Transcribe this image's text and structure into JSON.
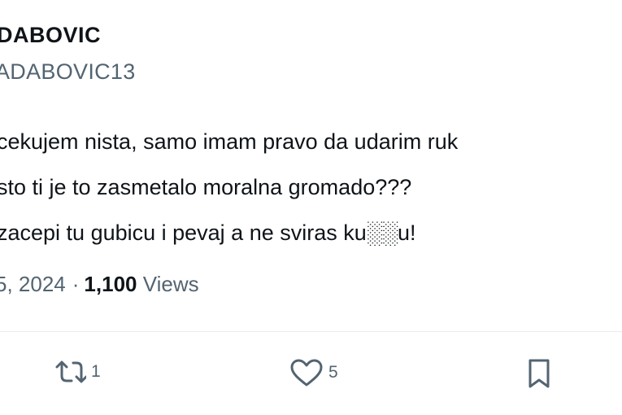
{
  "author": {
    "display_name": "DABOVIC",
    "handle": "ADABOVIC13"
  },
  "tweet": {
    "lines": [
      "cekujem nista, samo imam pravo da udarim ruk",
      "sto ti je to zasmetalo moralna gromado???",
      "zacepi tu gubicu i pevaj a ne sviras ku░░u!"
    ]
  },
  "meta": {
    "date": "5, 2024",
    "separator": "·",
    "views_count": "1,100",
    "views_label": "Views"
  },
  "actions": {
    "retweet_count": "1",
    "like_count": "5"
  },
  "icons": {
    "retweet": "retweet-icon",
    "like": "heart-icon",
    "bookmark": "bookmark-icon"
  },
  "colors": {
    "text": "#0f1419",
    "secondary": "#536471",
    "divider": "#e6ecf0"
  }
}
